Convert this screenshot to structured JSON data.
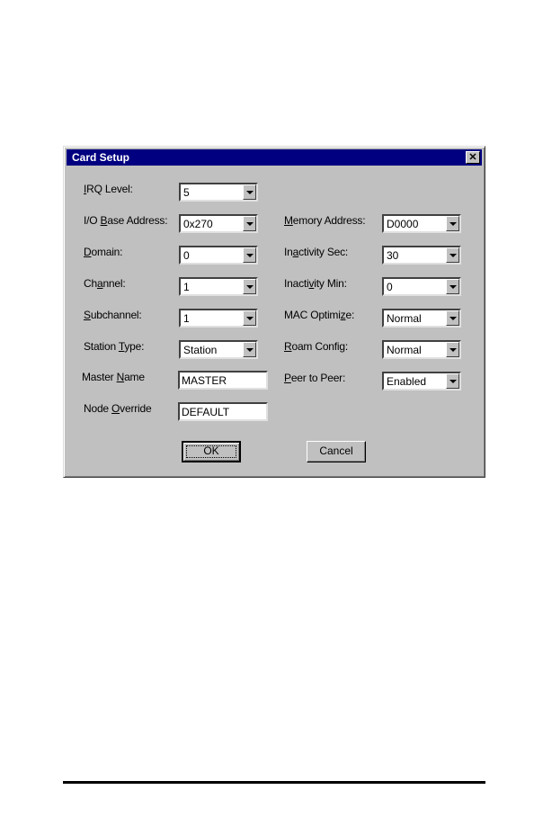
{
  "dialog": {
    "title": "Card Setup",
    "close_label": "✕",
    "left_fields": [
      {
        "label_pre": "",
        "label_key": "I",
        "label_post": "RQ Level:",
        "value": "5",
        "type": "combo"
      },
      {
        "label_pre": "I/O ",
        "label_key": "B",
        "label_post": "ase Address:",
        "value": "0x270",
        "type": "combo"
      },
      {
        "label_pre": "",
        "label_key": "D",
        "label_post": "omain:",
        "value": "0",
        "type": "combo"
      },
      {
        "label_pre": "Ch",
        "label_key": "a",
        "label_post": "nnel:",
        "value": "1",
        "type": "combo"
      },
      {
        "label_pre": "",
        "label_key": "S",
        "label_post": "ubchannel:",
        "value": "1",
        "type": "combo"
      },
      {
        "label_pre": "Station ",
        "label_key": "T",
        "label_post": "ype:",
        "value": "Station",
        "type": "combo"
      },
      {
        "label_pre": "Master ",
        "label_key": "N",
        "label_post": "ame",
        "value": "MASTER",
        "type": "text"
      },
      {
        "label_pre": "Node ",
        "label_key": "O",
        "label_post": "verride",
        "value": "DEFAULT",
        "type": "text"
      }
    ],
    "right_fields": [
      {
        "label_pre": "",
        "label_key": "M",
        "label_post": "emory Address:",
        "value": "D0000"
      },
      {
        "label_pre": "In",
        "label_key": "a",
        "label_post": "ctivity Sec:",
        "value": "30"
      },
      {
        "label_pre": "Inacti",
        "label_key": "v",
        "label_post": "ity Min:",
        "value": "0"
      },
      {
        "label_pre": "MAC Optimi",
        "label_key": "z",
        "label_post": "e:",
        "value": "Normal"
      },
      {
        "label_pre": "",
        "label_key": "R",
        "label_post": "oam Config:",
        "value": "Normal"
      },
      {
        "label_pre": "",
        "label_key": "P",
        "label_post": "eer to Peer:",
        "value": "Enabled"
      }
    ],
    "ok_label": "OK",
    "cancel_label": "Cancel"
  }
}
